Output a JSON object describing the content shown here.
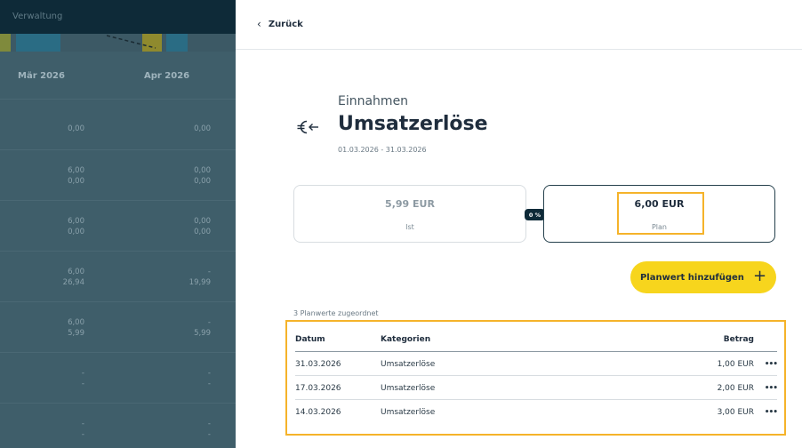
{
  "background_panel": {
    "title": "Verwaltung",
    "columns": [
      "Mär 2026",
      "Apr 2026"
    ],
    "rows": [
      [
        [
          "0,00"
        ],
        [
          "0,00"
        ]
      ],
      [
        [
          "6,00",
          "0,00"
        ],
        [
          "0,00",
          "0,00"
        ]
      ],
      [
        [
          "6,00",
          "0,00"
        ],
        [
          "0,00",
          "0,00"
        ]
      ],
      [
        [
          "6,00",
          "26,94"
        ],
        [
          "-",
          "19,99"
        ]
      ],
      [
        [
          "6,00",
          "5,99"
        ],
        [
          "-",
          "5,99"
        ]
      ],
      [
        [
          "-",
          "-"
        ],
        [
          "-",
          "-"
        ]
      ],
      [
        [
          "-",
          "-"
        ],
        [
          "-",
          "-"
        ]
      ]
    ]
  },
  "header": {
    "back_label": "Zurück"
  },
  "category": {
    "type_label": "Einnahmen",
    "title": "Umsatzerlöse",
    "date_range": "01.03.2026 - 31.03.2026",
    "icon": "euro-arrow-left-icon"
  },
  "cards": {
    "ist": {
      "amount": "5,99 EUR",
      "label": "Ist"
    },
    "plan": {
      "amount": "6,00 EUR",
      "label": "Plan"
    },
    "badge": "0 %"
  },
  "add_button": {
    "label": "Planwert hinzufügen"
  },
  "table": {
    "assigned_text": "3 Planwerte zugeordnet",
    "headers": {
      "date": "Datum",
      "category": "Kategorien",
      "amount": "Betrag"
    },
    "rows": [
      {
        "date": "31.03.2026",
        "category": "Umsatzerlöse",
        "amount": "1,00 EUR"
      },
      {
        "date": "17.03.2026",
        "category": "Umsatzerlöse",
        "amount": "2,00 EUR"
      },
      {
        "date": "14.03.2026",
        "category": "Umsatzerlöse",
        "amount": "3,00 EUR"
      }
    ]
  },
  "colors": {
    "accent_yellow": "#f7d51d",
    "highlight_orange": "#f5b32a",
    "dark_navy": "#0e2a38"
  }
}
